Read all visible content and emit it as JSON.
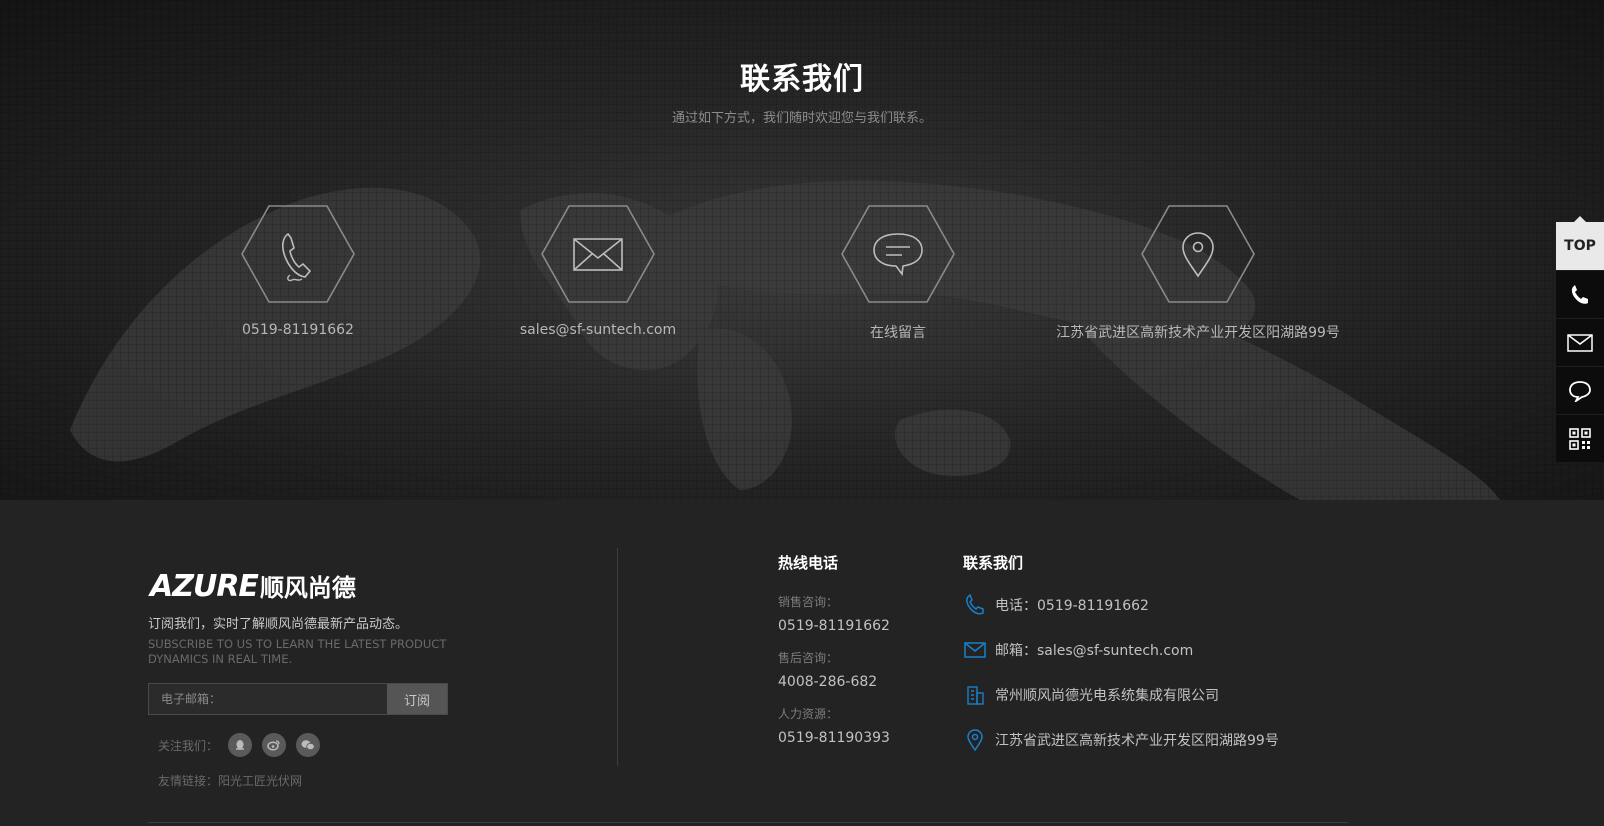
{
  "contact_section": {
    "title": "联系我们",
    "subtitle": "通过如下方式，我们随时欢迎您与我们联系。",
    "items": [
      {
        "icon": "phone-icon",
        "label": "0519-81191662"
      },
      {
        "icon": "envelope-icon",
        "label": "sales@sf-suntech.com"
      },
      {
        "icon": "chat-bubble-icon",
        "label": "在线留言"
      },
      {
        "icon": "location-pin-icon",
        "label": "江苏省武进区高新技术产业开发区阳湖路99号"
      }
    ]
  },
  "footer": {
    "logo": {
      "en": "AZURE",
      "cn": "顺风尚德"
    },
    "subscribe": {
      "text_cn": "订阅我们，实时了解顺风尚德最新产品动态。",
      "text_en": "SUBSCRIBE TO US TO LEARN THE LATEST PRODUCT DYNAMICS IN REAL TIME.",
      "placeholder": "电子邮箱：",
      "button": "订阅"
    },
    "follow_label": "关注我们：",
    "social_icons": [
      "qq-icon",
      "weibo-icon",
      "wechat-icon"
    ],
    "friend_links": "友情链接：阳光工匠光伏网",
    "hotline": {
      "title": "热线电话",
      "entries": [
        {
          "label": "销售咨询：",
          "value": "0519-81191662"
        },
        {
          "label": "售后咨询：",
          "value": "4008-286-682"
        },
        {
          "label": "人力资源：",
          "value": "0519-81190393"
        }
      ]
    },
    "contact": {
      "title": "联系我们",
      "rows": [
        {
          "icon": "phone-icon",
          "text": "电话：0519-81191662"
        },
        {
          "icon": "envelope-icon",
          "text": "邮箱：sales@sf-suntech.com"
        },
        {
          "icon": "building-icon",
          "text": "常州顺风尚德光电系统集成有限公司"
        },
        {
          "icon": "location-pin-icon",
          "text": "江苏省武进区高新技术产业开发区阳湖路99号"
        }
      ]
    }
  },
  "side_bar": {
    "top_label": "TOP",
    "buttons": [
      "phone-icon",
      "envelope-icon",
      "chat-bubble-icon",
      "qr-code-icon"
    ]
  },
  "colors": {
    "accent_blue": "#1a7fc9",
    "hero_text": "#ffffff",
    "footer_bg": "#232323"
  }
}
